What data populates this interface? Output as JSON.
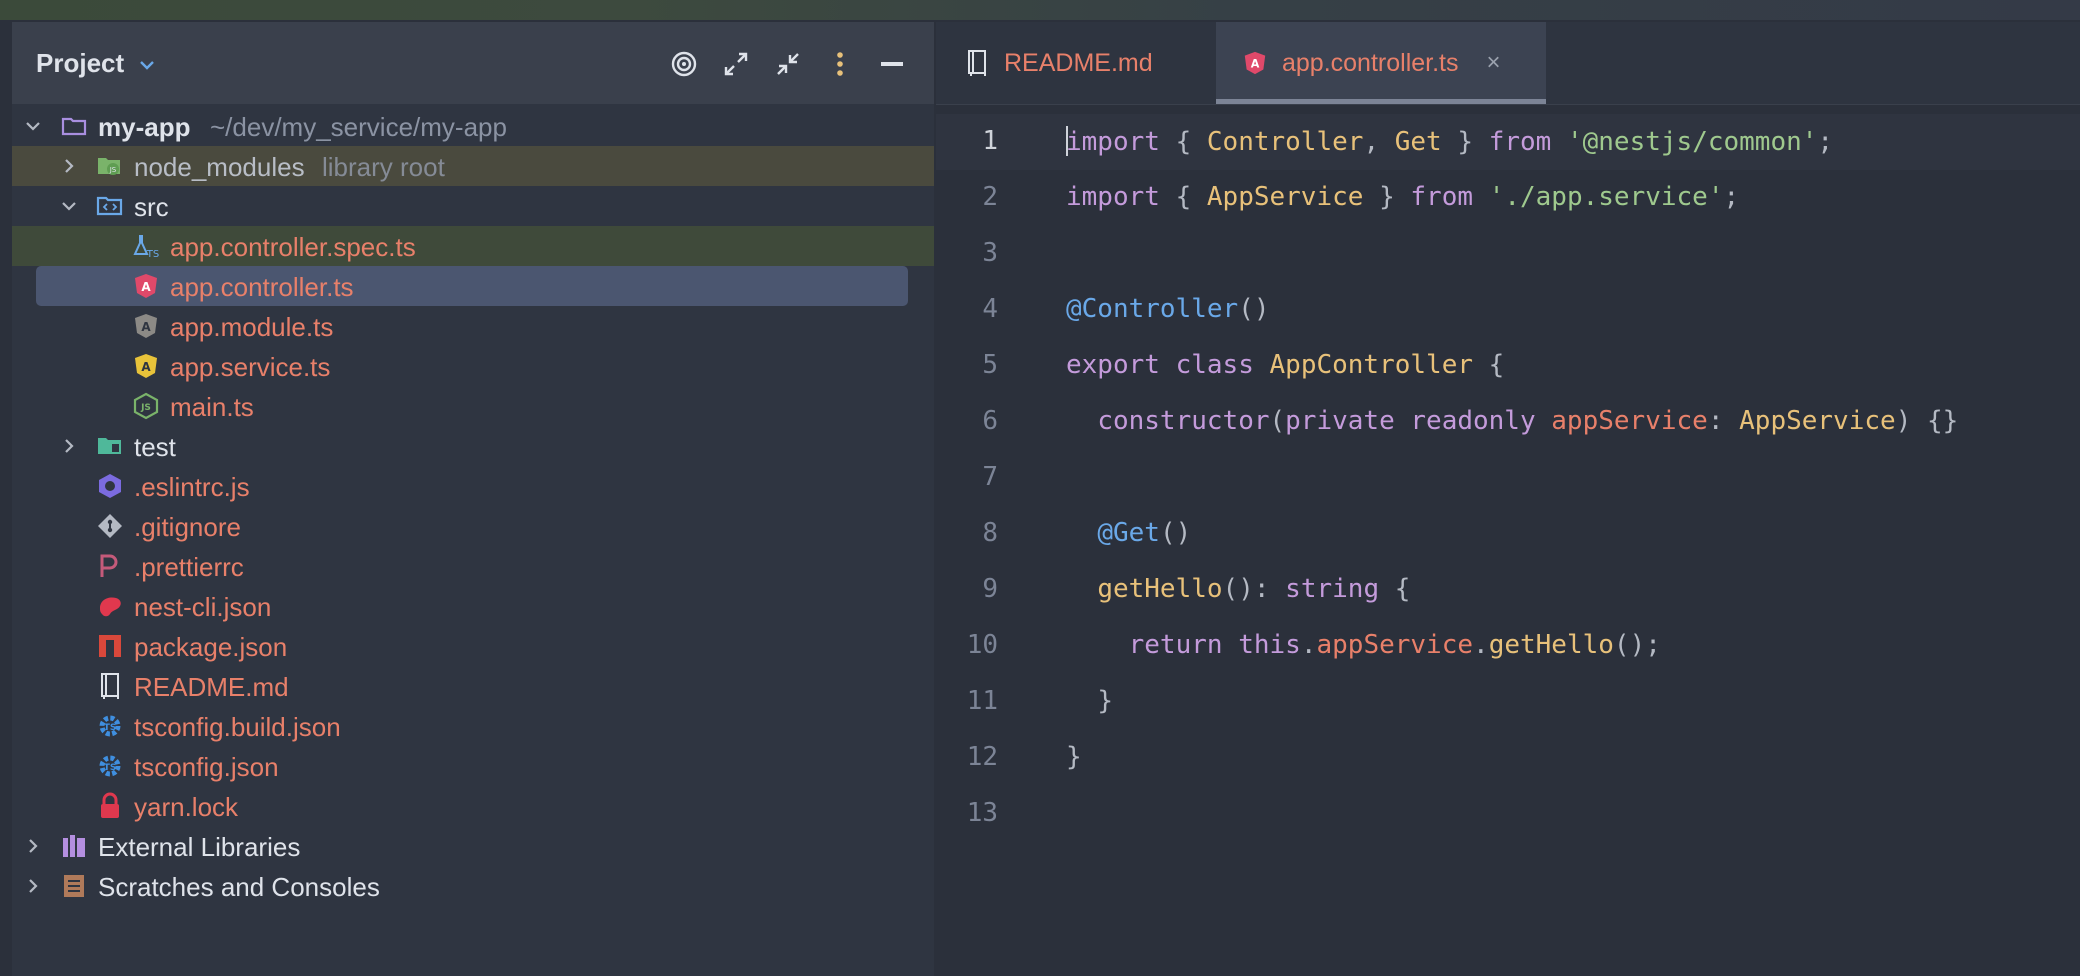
{
  "colors": {
    "background": "#2b303b",
    "panel": "#2f3541",
    "selection": "#4b5670",
    "file_modified": "#e8806a",
    "keyword": "#c49bdb",
    "type": "#e8c17a",
    "string": "#9fc98e",
    "decorator": "#6aa8e8"
  },
  "project": {
    "title": "Project",
    "toolbar_icons": [
      "target-icon",
      "expand-all-icon",
      "collapse-all-icon",
      "more-options-icon",
      "minimize-icon"
    ],
    "tree": {
      "root": {
        "label": "my-app",
        "path": "~/dev/my_service/my-app"
      },
      "node_modules": {
        "label": "node_modules",
        "hint": "library root"
      },
      "src": {
        "label": "src"
      },
      "files_src": [
        {
          "label": "app.controller.spec.ts",
          "icon": "test-ts-icon"
        },
        {
          "label": "app.controller.ts",
          "icon": "angular-red-icon"
        },
        {
          "label": "app.module.ts",
          "icon": "angular-gray-icon"
        },
        {
          "label": "app.service.ts",
          "icon": "angular-yellow-icon"
        },
        {
          "label": "main.ts",
          "icon": "nodejs-icon"
        }
      ],
      "test": {
        "label": "test"
      },
      "files_root": [
        {
          "label": ".eslintrc.js",
          "icon": "eslint-icon"
        },
        {
          "label": ".gitignore",
          "icon": "git-icon"
        },
        {
          "label": ".prettierrc",
          "icon": "prettier-icon"
        },
        {
          "label": "nest-cli.json",
          "icon": "nestjs-icon"
        },
        {
          "label": "package.json",
          "icon": "npm-icon"
        },
        {
          "label": "README.md",
          "icon": "readme-icon"
        },
        {
          "label": "tsconfig.build.json",
          "icon": "tsconfig-icon"
        },
        {
          "label": "tsconfig.json",
          "icon": "tsconfig-icon"
        },
        {
          "label": "yarn.lock",
          "icon": "lock-icon"
        }
      ],
      "external_libraries": {
        "label": "External Libraries"
      },
      "scratches": {
        "label": "Scratches and Consoles"
      }
    }
  },
  "editor": {
    "tabs": [
      {
        "label": "README.md",
        "active": false
      },
      {
        "label": "app.controller.ts",
        "active": true,
        "close": "×"
      }
    ],
    "line_numbers": [
      "1",
      "2",
      "3",
      "4",
      "5",
      "6",
      "7",
      "8",
      "9",
      "10",
      "11",
      "12",
      "13"
    ],
    "code": {
      "l1": {
        "kw1": "import",
        "p1": " { ",
        "c1": "Controller",
        "p2": ", ",
        "c2": "Get",
        "p3": " } ",
        "kw2": "from",
        "p4": " ",
        "s1": "'@nestjs/common'",
        "p5": ";"
      },
      "l2": {
        "kw1": "import",
        "p1": " { ",
        "c1": "AppService",
        "p2": " } ",
        "kw2": "from",
        "p3": " ",
        "s1": "'./app.service'",
        "p4": ";"
      },
      "l4": {
        "d1": "@Controller",
        "p1": "()"
      },
      "l5": {
        "kw1": "export",
        "p1": " ",
        "kw2": "class",
        "p2": " ",
        "c1": "AppController",
        "p3": " {"
      },
      "l6": {
        "ind": "  ",
        "f1": "constructor",
        "p1": "(",
        "kw1": "private",
        "p2": " ",
        "kw2": "readonly",
        "p3": " ",
        "v1": "appService",
        "p4": ": ",
        "c1": "AppService",
        "p5": ") {}"
      },
      "l8": {
        "ind": "  ",
        "d1": "@Get",
        "p1": "()"
      },
      "l9": {
        "ind": "  ",
        "f1": "getHello",
        "p1": "(): ",
        "kw1": "string",
        "p2": " {"
      },
      "l10": {
        "ind": "    ",
        "kw1": "return",
        "p1": " ",
        "kw2": "this",
        "p2": ".",
        "v1": "appService",
        "p3": ".",
        "f1": "getHello",
        "p4": "();"
      },
      "l11": {
        "ind": "  ",
        "p1": "}"
      },
      "l12": {
        "p1": "}"
      }
    }
  }
}
